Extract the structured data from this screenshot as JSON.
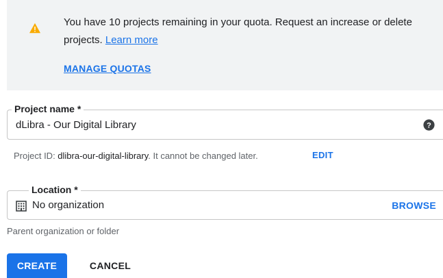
{
  "quota_banner": {
    "message": "You have 10 projects remaining in your quota. Request an increase or delete projects.",
    "learn_more_label": "Learn more",
    "manage_quotas_label": "MANAGE QUOTAS",
    "icon": "warning-icon",
    "icon_color": "#f9ab00"
  },
  "project_name": {
    "label": "Project name *",
    "value": "dLibra - Our Digital Library",
    "help_icon": "help-icon"
  },
  "project_id": {
    "prefix": "Project ID: ",
    "id": "dlibra-our-digital-library",
    "suffix": ". It cannot be changed later.",
    "edit_label": "EDIT"
  },
  "location": {
    "label": "Location *",
    "value": "No organization",
    "icon": "building-icon",
    "browse_label": "BROWSE",
    "helper_text": "Parent organization or folder"
  },
  "actions": {
    "create_label": "CREATE",
    "cancel_label": "CANCEL"
  },
  "colors": {
    "accent": "#1a73e8",
    "banner_bg": "#f1f3f4",
    "border": "#c6c6c6"
  }
}
